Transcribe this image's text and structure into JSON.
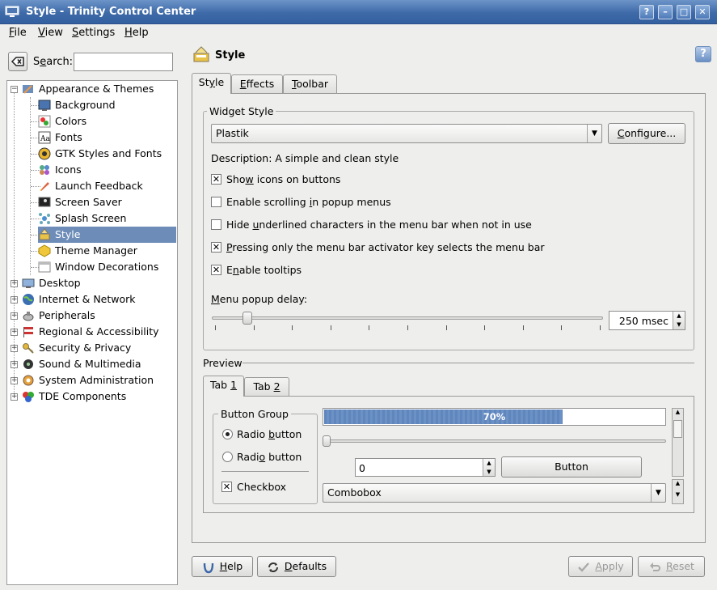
{
  "window": {
    "title": "Style - Trinity Control Center"
  },
  "menu": [
    {
      "pre": "",
      "u": "F",
      "post": "ile"
    },
    {
      "pre": "",
      "u": "V",
      "post": "iew"
    },
    {
      "pre": "",
      "u": "S",
      "post": "ettings"
    },
    {
      "pre": "",
      "u": "H",
      "post": "elp"
    }
  ],
  "search": {
    "pre": "S",
    "u": "e",
    "post": "arch:",
    "value": ""
  },
  "tree": {
    "appearance": "Appearance & Themes",
    "children": [
      "Background",
      "Colors",
      "Fonts",
      "GTK Styles and Fonts",
      "Icons",
      "Launch Feedback",
      "Screen Saver",
      "Splash Screen",
      "Style",
      "Theme Manager",
      "Window Decorations"
    ],
    "selected": "Style",
    "top": [
      "Desktop",
      "Internet & Network",
      "Peripherals",
      "Regional & Accessibility",
      "Security & Privacy",
      "Sound & Multimedia",
      "System Administration",
      "TDE Components"
    ]
  },
  "header": {
    "title": "Style"
  },
  "tabs": [
    {
      "pre": "St",
      "u": "y",
      "post": "le"
    },
    {
      "pre": "",
      "u": "E",
      "post": "ffects"
    },
    {
      "pre": "",
      "u": "T",
      "post": "oolbar"
    }
  ],
  "widget_style": {
    "legend": "Widget Style",
    "selected": "Plastik",
    "configure": {
      "pre": "",
      "u": "C",
      "post": "onfigure..."
    },
    "description": "Description: A simple and clean style"
  },
  "options": [
    {
      "pre": "Sho",
      "u": "w",
      "post": " icons on buttons",
      "checked": true
    },
    {
      "pre": "Enable scrolling ",
      "u": "i",
      "post": "n popup menus",
      "checked": false
    },
    {
      "pre": "Hide ",
      "u": "u",
      "post": "nderlined characters in the menu bar when not in use",
      "checked": false
    },
    {
      "pre": "",
      "u": "P",
      "post": "ressing only the menu bar activator key selects the menu bar",
      "checked": true
    },
    {
      "pre": "E",
      "u": "n",
      "post": "able tooltips",
      "checked": true
    }
  ],
  "menu_popup_delay": {
    "pre": "",
    "u": "M",
    "post": "enu popup delay:",
    "value": "250 msec",
    "fraction": 0.05
  },
  "preview": {
    "legend": "Preview",
    "tabs": [
      {
        "pre": "Tab ",
        "u": "1",
        "post": ""
      },
      {
        "pre": "Tab ",
        "u": "2",
        "post": ""
      }
    ],
    "button_group": "Button Group",
    "radio1": {
      "pre": "Radio ",
      "u": "b",
      "post": "utton"
    },
    "radio2": {
      "pre": "Radi",
      "u": "o",
      "post": " button"
    },
    "checkbox": "Checkbox",
    "progress": {
      "value": 0.7,
      "label": "70%"
    },
    "spin_value": "0",
    "button": "Button",
    "combobox": "Combobox"
  },
  "footer": {
    "help": {
      "pre": "",
      "u": "H",
      "post": "elp"
    },
    "defaults": {
      "pre": "",
      "u": "D",
      "post": "efaults"
    },
    "apply": {
      "pre": "",
      "u": "A",
      "post": "pply"
    },
    "reset": {
      "pre": "",
      "u": "R",
      "post": "eset"
    }
  },
  "colors": {
    "selection": "#6d8cb8",
    "titlebar": "#3e6aa8"
  }
}
